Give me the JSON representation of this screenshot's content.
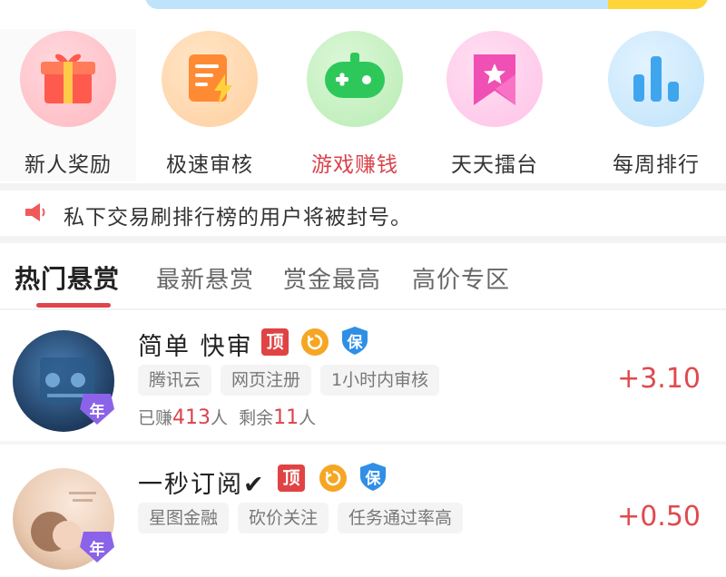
{
  "quick_menu": [
    {
      "label": "新人奖励",
      "icon": "gift-icon"
    },
    {
      "label": "极速审核",
      "icon": "document-lightning-icon"
    },
    {
      "label": "游戏赚钱",
      "icon": "gamepad-icon"
    },
    {
      "label": "天天擂台",
      "icon": "bookmark-star-icon"
    },
    {
      "label": "每周排行",
      "icon": "bar-chart-icon"
    }
  ],
  "notice": {
    "text": "私下交易刷排行榜的用户将被封号。",
    "icon": "speaker-icon"
  },
  "tabs": [
    "热门悬赏",
    "最新悬赏",
    "赏金最高",
    "高价专区"
  ],
  "tasks": [
    {
      "title": "简单 快审",
      "tag_top": "顶",
      "tag_bao": "保",
      "year_badge": "年",
      "chips": [
        "腾讯云",
        "网页注册",
        "1小时内审核"
      ],
      "earned_prefix": "已赚",
      "earned": "413",
      "earned_unit": "人",
      "remaining_prefix": "剩余",
      "remaining": "11",
      "remaining_unit": "人",
      "price": "+3.10"
    },
    {
      "title": "一秒订阅✔",
      "tag_top": "顶",
      "tag_bao": "保",
      "year_badge": "年",
      "chips": [
        "星图金融",
        "砍价关注",
        "任务通过率高"
      ],
      "price": "+0.50"
    }
  ],
  "colors": {
    "accent": "#e0494f",
    "tab_underline": "#e1434a",
    "tag_top": "#e04343",
    "tag_refresh": "#f5a623",
    "tag_bao": "#2f8fe6"
  }
}
